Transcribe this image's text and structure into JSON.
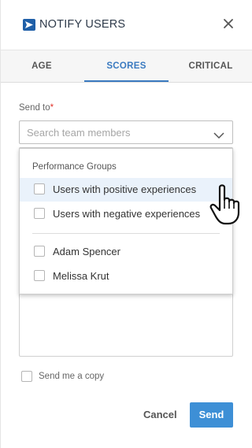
{
  "header": {
    "title": "NOTIFY USERS",
    "logo_icon": "send-arrow-icon",
    "close_icon": "close-icon"
  },
  "tabs": [
    {
      "label": "AGE",
      "active": false
    },
    {
      "label": "SCORES",
      "active": true
    },
    {
      "label": "CRITICAL",
      "active": false
    }
  ],
  "form": {
    "send_to_label": "Send to",
    "required_marker": "*",
    "search_placeholder": "Search team members",
    "search_value": ""
  },
  "dropdown": {
    "group_title": "Performance Groups",
    "groups": [
      {
        "label": "Users with positive experiences",
        "checked": false,
        "hovered": true
      },
      {
        "label": "Users with negative experiences",
        "checked": false,
        "hovered": false
      }
    ],
    "members": [
      {
        "label": "Adam Spencer",
        "checked": false
      },
      {
        "label": "Melissa Krut",
        "checked": false
      }
    ]
  },
  "footer": {
    "copy_label": "Send me a copy",
    "copy_checked": false,
    "cancel_label": "Cancel",
    "send_label": "Send"
  },
  "colors": {
    "accent": "#3a7ac0",
    "send_button": "#3d8fd6",
    "required": "#e2332b",
    "hover_row": "#eaf2fb"
  }
}
